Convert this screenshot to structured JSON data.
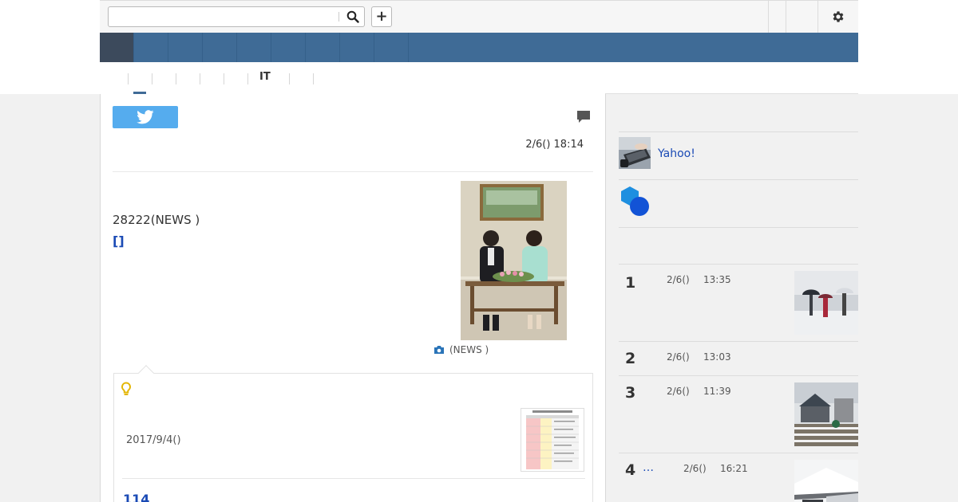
{
  "search": {
    "value": "",
    "placeholder": ""
  },
  "toolbar": {
    "add_label": "+"
  },
  "subnav": {
    "items": [
      "",
      "",
      "",
      "",
      "",
      "IT",
      "",
      ""
    ]
  },
  "article": {
    "date": "2/6() 18:14",
    "lead_text": "28222(NEWS )",
    "lead_link": "[]",
    "photo_caption": "(NEWS )"
  },
  "related": {
    "date": "2017/9/4()",
    "count": "114"
  },
  "side": {
    "yahoo_label": "Yahoo!"
  },
  "ranking": {
    "items": [
      {
        "num": "1",
        "date": "2/6()",
        "time": "13:35",
        "more": ""
      },
      {
        "num": "2",
        "date": "2/6()",
        "time": "13:03",
        "more": ""
      },
      {
        "num": "3",
        "date": "2/6()",
        "time": "11:39",
        "more": ""
      },
      {
        "num": "4",
        "date": "2/6()",
        "time": "16:21",
        "more": "…"
      }
    ]
  },
  "colors": {
    "nav_blue": "#3f6b96",
    "nav_active": "#3c4a5c",
    "link_blue": "#1a4ab5",
    "twitter_blue": "#55acee"
  },
  "icons": {
    "search": "search-icon",
    "settings": "gear-icon",
    "twitter": "twitter-icon",
    "comment": "comment-icon",
    "camera": "camera-icon",
    "tip": "lightbulb-icon"
  }
}
